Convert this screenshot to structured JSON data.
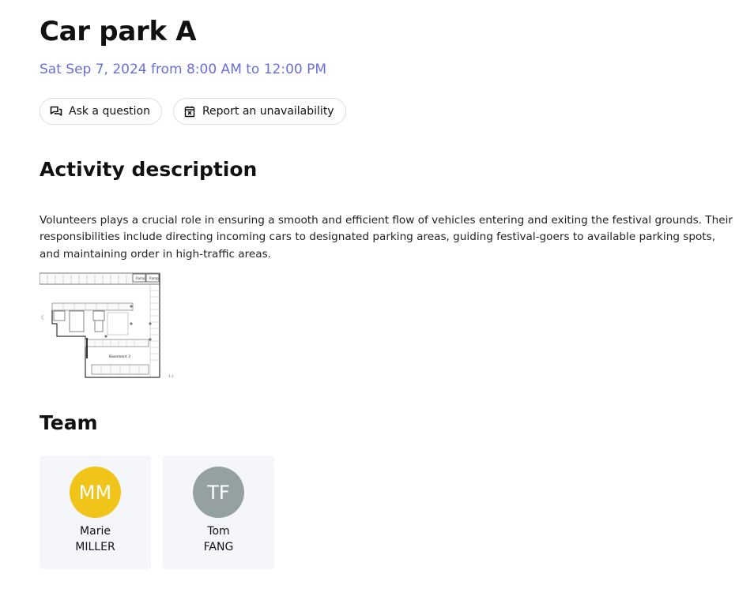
{
  "activity": {
    "title": "Car park A",
    "datetime": "Sat Sep 7, 2024 from 8:00 AM to 12:00 PM"
  },
  "actions": {
    "ask_label": "Ask a question",
    "ask_icon": "chat-bubbles-icon",
    "report_label": "Report an unavailability",
    "report_icon": "calendar-x-icon"
  },
  "description": {
    "heading": "Activity description",
    "text": "Volunteers plays a crucial role in ensuring a smooth and efficient flow of vehicles entering and exiting the festival grounds. Their responsibilities include directing incoming cars to designated parking areas, guiding festival-goers to available parking spots, and maintaining order in high-traffic areas.",
    "map": {
      "label": "Basement 3",
      "scale": "1:1",
      "ramp_labels": [
        "Ramp",
        "Ramp"
      ]
    }
  },
  "team": {
    "heading": "Team",
    "members": [
      {
        "initials": "MM",
        "first_name": "Marie",
        "last_name": "MILLER",
        "color": "#f0c419"
      },
      {
        "initials": "TF",
        "first_name": "Tom",
        "last_name": "FANG",
        "color": "#95a0a0"
      }
    ]
  },
  "colors": {
    "accent": "#6a6fd6",
    "card_bg": "#f5f6f9"
  }
}
